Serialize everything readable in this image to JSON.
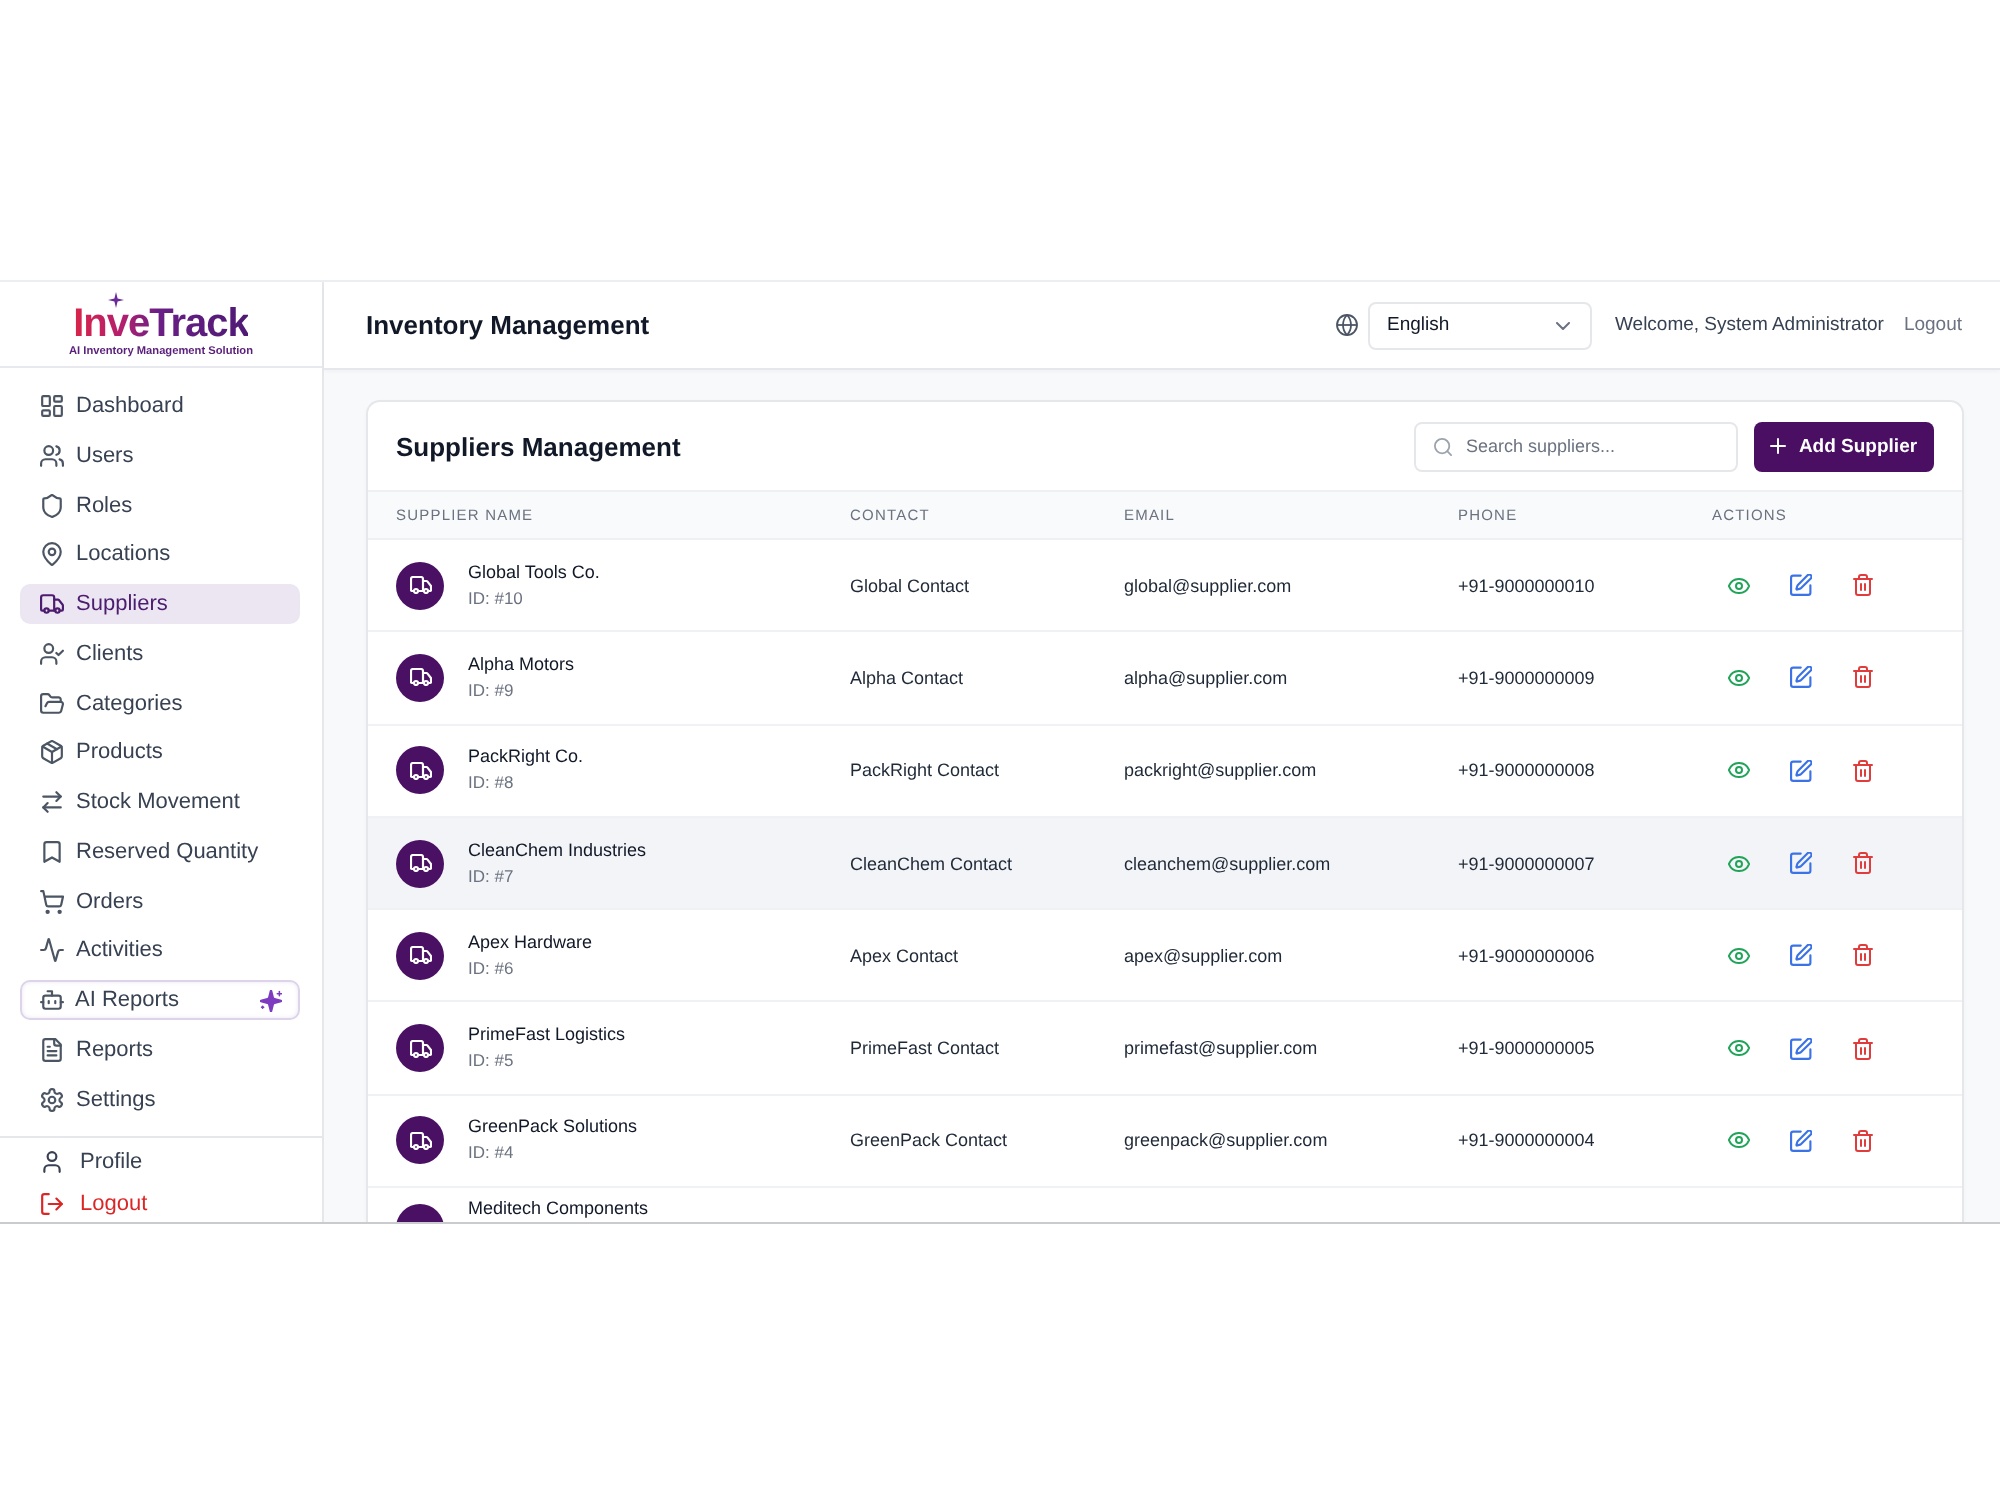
{
  "sidebar": {
    "logo": {
      "name": "InveTrack",
      "tagline": "AI Inventory Management Solution"
    },
    "nav": [
      {
        "label": "Dashboard",
        "selected": false,
        "featured": false
      },
      {
        "label": "Users",
        "selected": false,
        "featured": false
      },
      {
        "label": "Roles",
        "selected": false,
        "featured": false
      },
      {
        "label": "Locations",
        "selected": false,
        "featured": false
      },
      {
        "label": "Suppliers",
        "selected": true,
        "featured": false
      },
      {
        "label": "Clients",
        "selected": false,
        "featured": false
      },
      {
        "label": "Categories",
        "selected": false,
        "featured": false
      },
      {
        "label": "Products",
        "selected": false,
        "featured": false
      },
      {
        "label": "Stock Movement",
        "selected": false,
        "featured": false
      },
      {
        "label": "Reserved Quantity",
        "selected": false,
        "featured": false
      },
      {
        "label": "Orders",
        "selected": false,
        "featured": false
      },
      {
        "label": "Activities",
        "selected": false,
        "featured": false
      },
      {
        "label": "AI Reports",
        "selected": false,
        "featured": true
      },
      {
        "label": "Reports",
        "selected": false,
        "featured": false
      },
      {
        "label": "Settings",
        "selected": false,
        "featured": false
      }
    ],
    "footer": [
      {
        "label": "Profile",
        "kind": "normal"
      },
      {
        "label": "Logout",
        "kind": "danger"
      }
    ]
  },
  "header": {
    "title": "Inventory Management",
    "language": "English",
    "welcome": "Welcome, System Administrator",
    "logout": "Logout"
  },
  "card": {
    "title": "Suppliers Management",
    "search": {
      "placeholder": "Search suppliers..."
    },
    "add_button": "Add Supplier"
  },
  "table": {
    "columns": [
      "SUPPLIER NAME",
      "CONTACT",
      "EMAIL",
      "PHONE",
      "ACTIONS"
    ],
    "rows": [
      {
        "kind": "full",
        "name": "Global Tools Co.",
        "id": "ID: #10",
        "contact": "Global Contact",
        "email": "global@supplier.com",
        "phone": "+91-9000000010",
        "hovered": false
      },
      {
        "kind": "full",
        "name": "Alpha Motors",
        "id": "ID: #9",
        "contact": "Alpha Contact",
        "email": "alpha@supplier.com",
        "phone": "+91-9000000009",
        "hovered": false
      },
      {
        "kind": "full",
        "name": "PackRight Co.",
        "id": "ID: #8",
        "contact": "PackRight Contact",
        "email": "packright@supplier.com",
        "phone": "+91-9000000008",
        "hovered": false
      },
      {
        "kind": "full",
        "name": "CleanChem Industries",
        "id": "ID: #7",
        "contact": "CleanChem Contact",
        "email": "cleanchem@supplier.com",
        "phone": "+91-9000000007",
        "hovered": true
      },
      {
        "kind": "full",
        "name": "Apex Hardware",
        "id": "ID: #6",
        "contact": "Apex Contact",
        "email": "apex@supplier.com",
        "phone": "+91-9000000006",
        "hovered": false
      },
      {
        "kind": "full",
        "name": "PrimeFast Logistics",
        "id": "ID: #5",
        "contact": "PrimeFast Contact",
        "email": "primefast@supplier.com",
        "phone": "+91-9000000005",
        "hovered": false
      },
      {
        "kind": "full",
        "name": "GreenPack Solutions",
        "id": "ID: #4",
        "contact": "GreenPack Contact",
        "email": "greenpack@supplier.com",
        "phone": "+91-9000000004",
        "hovered": false
      },
      {
        "kind": "cut",
        "name": "Meditech Components",
        "hovered": false
      }
    ]
  }
}
